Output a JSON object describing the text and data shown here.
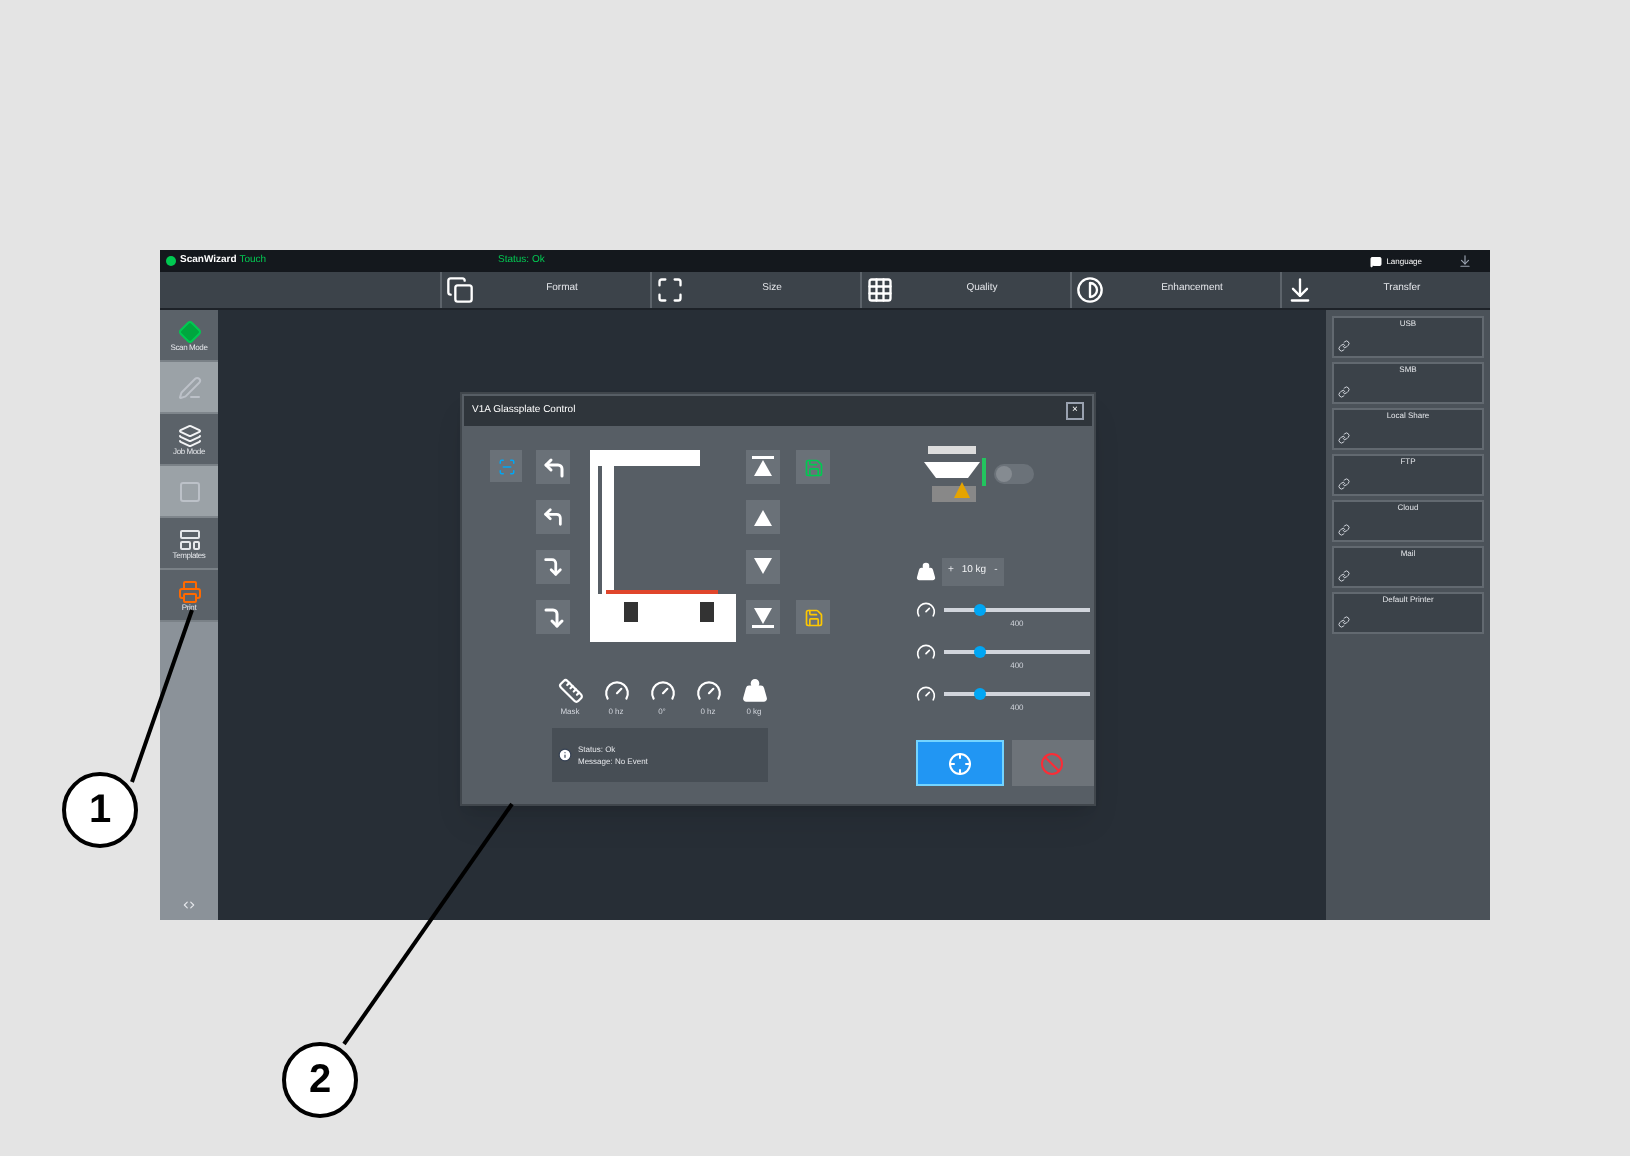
{
  "app": {
    "logo": "ScanWizard",
    "logo_suffix": "Touch",
    "status": "Status: Ok",
    "language": "Language"
  },
  "tabs": [
    {
      "kind": "format",
      "label": "Format"
    },
    {
      "kind": "size",
      "label": "Size"
    },
    {
      "kind": "quality",
      "label": "Quality"
    },
    {
      "kind": "enhancement",
      "label": "Enhancement"
    },
    {
      "kind": "transfer",
      "label": "Transfer"
    }
  ],
  "sidebar": {
    "items": [
      {
        "kind": "start",
        "label": "Scan Mode",
        "disabled": false
      },
      {
        "kind": "pen",
        "disabled": true
      },
      {
        "kind": "stack",
        "label": "Job Mode",
        "disabled": false
      },
      {
        "kind": "frame",
        "disabled": true
      },
      {
        "kind": "templates",
        "label": "Templates",
        "disabled": false
      },
      {
        "kind": "print",
        "label": "Print",
        "disabled": false
      }
    ]
  },
  "destinations": [
    "USB",
    "SMB",
    "Local Share",
    "FTP",
    "Cloud",
    "Mail",
    "Default Printer"
  ],
  "dialog": {
    "title": "V1A Glassplate Control",
    "close": "×",
    "toggle_on": false,
    "stepper": {
      "increase": "+",
      "value": "10 kg",
      "decrease": "-"
    },
    "sliders": [
      {
        "level": 0.25,
        "reading": "400"
      },
      {
        "level": 0.25,
        "reading": "400"
      },
      {
        "level": 0.25,
        "reading": "400"
      }
    ],
    "indicators": [
      {
        "kind": "ruler",
        "label": "Mask"
      },
      {
        "kind": "gauge",
        "label": "0 hz"
      },
      {
        "kind": "gauge",
        "label": "0°"
      },
      {
        "kind": "gauge",
        "label": "0 hz"
      },
      {
        "kind": "weight",
        "label": "0 kg"
      }
    ],
    "status": "Status: Ok",
    "message": "Message: No Event"
  },
  "callouts": [
    "1",
    "2"
  ]
}
